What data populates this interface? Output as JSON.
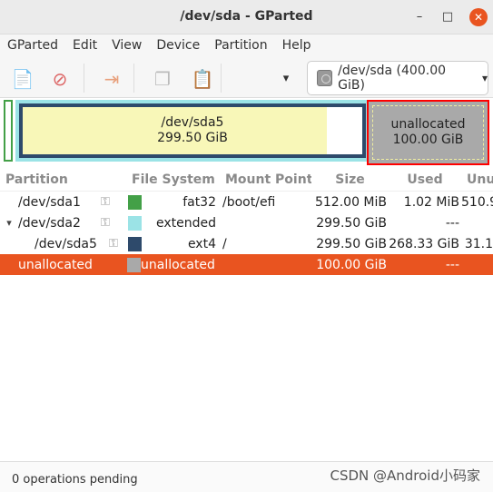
{
  "window": {
    "title": "/dev/sda - GParted",
    "minimize": "–",
    "maximize": "□",
    "close": "✕"
  },
  "menu": [
    "GParted",
    "Edit",
    "View",
    "Device",
    "Partition",
    "Help"
  ],
  "toolbar": {
    "icons": [
      "new-icon",
      "delete-icon",
      "apply-icon",
      "copy-icon",
      "paste-icon"
    ],
    "more": "▾"
  },
  "device_selector": {
    "value": "/dev/sda (400.00 GiB)",
    "arrow": "▾"
  },
  "disk_map": {
    "extended_color": "#9be3e6",
    "ext4_color": "#2e4a6b",
    "used_color": "#f8f7b8",
    "fat32_color": "#43a047",
    "unallocated_color": "#a9a9a9",
    "selected_border": "#ff0000",
    "sda5": {
      "name": "/dev/sda5",
      "size": "299.50 GiB",
      "used_fraction": 0.896
    },
    "unallocated": {
      "name": "unallocated",
      "size": "100.00 GiB"
    }
  },
  "table": {
    "columns": [
      "Partition",
      "File System",
      "Mount Point",
      "Size",
      "Used",
      "Unu"
    ],
    "rows": [
      {
        "partition": "/dev/sda1",
        "expander": "",
        "fs": "fat32",
        "color": "#43a047",
        "mount": "/boot/efi",
        "size": "512.00 MiB",
        "used": "1.02 MiB",
        "unused": "510.9",
        "key": true
      },
      {
        "partition": "/dev/sda2",
        "expander": "▾",
        "fs": "extended",
        "color": "#9be3e6",
        "mount": "",
        "size": "299.50 GiB",
        "used": "---",
        "unused": "",
        "key": true
      },
      {
        "partition": "/dev/sda5",
        "expander": "",
        "fs": "ext4",
        "color": "#2e4a6b",
        "mount": "/",
        "size": "299.50 GiB",
        "used": "268.33 GiB",
        "unused": "31.1",
        "key": true,
        "indent": true
      },
      {
        "partition": "unallocated",
        "expander": "",
        "fs": "unallocated",
        "color": "#a9a9a9",
        "mount": "",
        "size": "100.00 GiB",
        "used": "---",
        "unused": "",
        "key": false,
        "selected": true
      }
    ]
  },
  "status": "0 operations pending",
  "watermark": "CSDN @Android小码家"
}
